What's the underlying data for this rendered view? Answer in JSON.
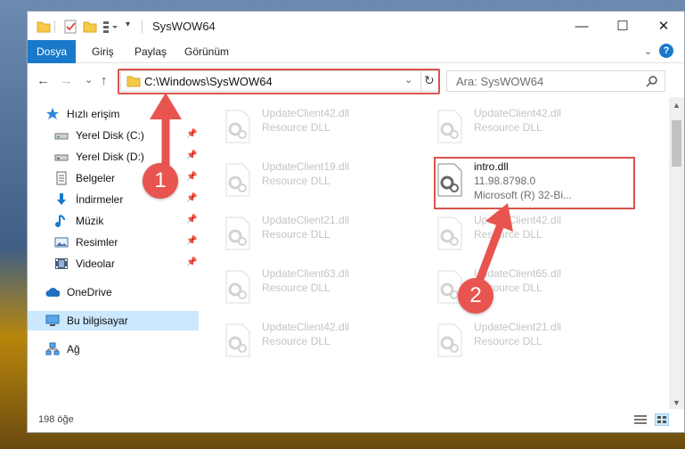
{
  "window": {
    "title": "SysWOW64",
    "minimize_glyph": "—",
    "maximize_glyph": "☐",
    "close_glyph": "✕"
  },
  "ribbon": {
    "tabs": [
      "Dosya",
      "Giriş",
      "Paylaş",
      "Görünüm"
    ],
    "help": "?"
  },
  "nav": {
    "back": "←",
    "forward": "→",
    "recent": "⌄",
    "up": "↑",
    "address": "C:\\Windows\\SysWOW64",
    "refresh": "↻",
    "search_placeholder": "Ara: SysWOW64"
  },
  "sidebar": {
    "items": [
      {
        "label": "Hızlı erişim",
        "icon": "star-icon"
      },
      {
        "label": "Yerel Disk (C:)",
        "icon": "drive-icon",
        "pinned": true
      },
      {
        "label": "Yerel Disk (D:)",
        "icon": "drive-icon",
        "pinned": true
      },
      {
        "label": "Belgeler",
        "icon": "documents-icon",
        "pinned": true
      },
      {
        "label": "İndirmeler",
        "icon": "download-icon",
        "pinned": true
      },
      {
        "label": "Müzik",
        "icon": "music-icon",
        "pinned": true
      },
      {
        "label": "Resimler",
        "icon": "pictures-icon",
        "pinned": true
      },
      {
        "label": "Videolar",
        "icon": "videos-icon",
        "pinned": true
      },
      {
        "label": "OneDrive",
        "icon": "cloud-icon"
      },
      {
        "label": "Bu bilgisayar",
        "icon": "computer-icon",
        "selected": true
      },
      {
        "label": "Ağ",
        "icon": "network-icon"
      }
    ]
  },
  "files": {
    "col1": [
      {
        "name": "UpdateClient42.dll",
        "sub": "Resource DLL"
      },
      {
        "name": "UpdateClient19.dll",
        "sub": "Resource DLL"
      },
      {
        "name": "UpdateClient21.dll",
        "sub": "Resource DLL"
      },
      {
        "name": "UpdateClient63.dll",
        "sub": "Resource DLL"
      },
      {
        "name": "UpdateClient42.dll",
        "sub": "Resource DLL"
      }
    ],
    "col2": [
      {
        "name": "UpdateClient42.dll",
        "sub": "Resource DLL"
      },
      {
        "name": "intro.dll",
        "sub1": "11.98.8798.0",
        "sub2": "Microsoft (R) 32-Bi...",
        "highlighted": true
      },
      {
        "name": "UpdateClient42.dll",
        "sub": "Resource DLL"
      },
      {
        "name": "UpdateClient65.dll",
        "sub": "Resource DLL"
      },
      {
        "name": "UpdateClient21.dll",
        "sub": "Resource DLL"
      }
    ]
  },
  "status": {
    "count": "198 öğe"
  },
  "annotations": {
    "badge1": "1",
    "badge2": "2",
    "color": "#e8544f"
  }
}
